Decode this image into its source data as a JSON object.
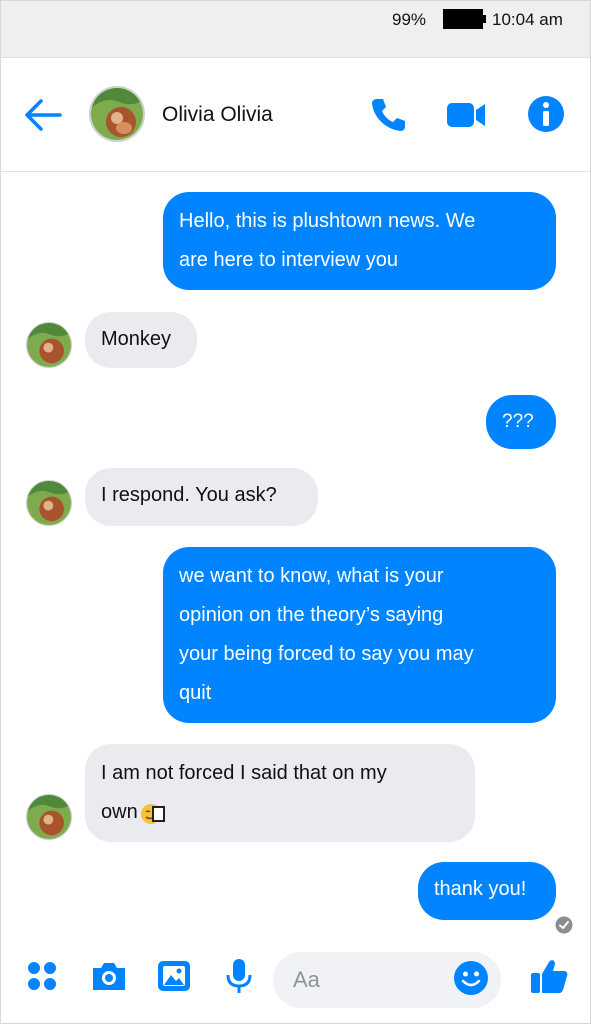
{
  "status_bar": {
    "battery_percent": "99%",
    "time": "10:04 am"
  },
  "header": {
    "contact_name": "Olivia Olivia"
  },
  "messages": [
    {
      "sender": "me",
      "lines": [
        "Hello, this is plushtown news. We",
        "are here to interview you"
      ]
    },
    {
      "sender": "contact",
      "lines": [
        "Monkey"
      ]
    },
    {
      "sender": "me",
      "lines": [
        "???"
      ]
    },
    {
      "sender": "contact",
      "lines": [
        "I respond.  You ask?"
      ]
    },
    {
      "sender": "me",
      "lines": [
        "we want to know, what is your",
        "opinion on the theory’s saying",
        "your being forced to say you may",
        "quit"
      ]
    },
    {
      "sender": "contact",
      "lines": [
        "I am not forced I said that on my",
        "own"
      ]
    },
    {
      "sender": "me",
      "lines": [
        "thank you!"
      ]
    }
  ],
  "composer": {
    "placeholder": "Aa"
  },
  "colors": {
    "accent": "#0084ff",
    "incoming_bubble": "#e9ebee"
  }
}
